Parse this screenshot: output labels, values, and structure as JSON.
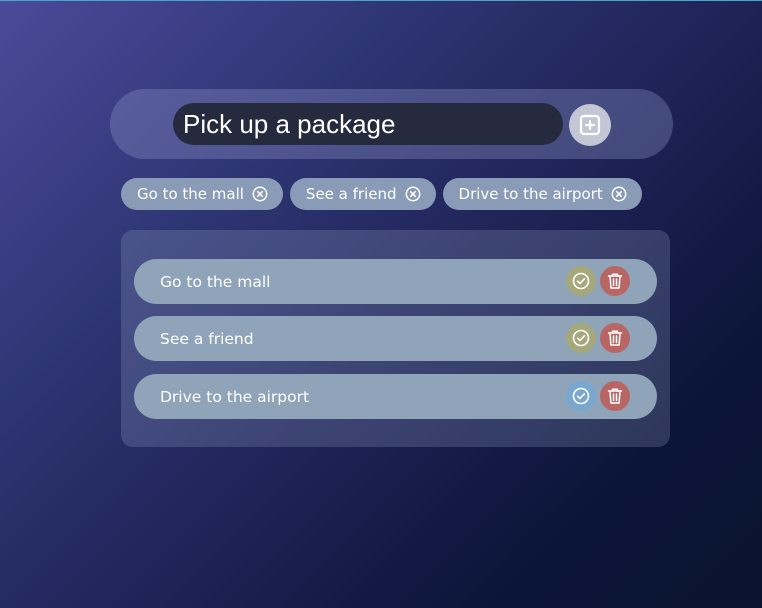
{
  "input": {
    "value": "Pick up a package"
  },
  "icons": {
    "add": "plus-square-icon",
    "remove": "x-circle-icon",
    "complete": "check-circle-icon",
    "delete": "trash-icon"
  },
  "colors": {
    "check_done": "#a4a87a",
    "check_pending": "#79a7cf",
    "delete": "#b86664"
  },
  "chips": [
    {
      "label": "Go to the mall"
    },
    {
      "label": "See a friend"
    },
    {
      "label": "Drive to the airport"
    }
  ],
  "tasks": [
    {
      "label": "Go to the mall",
      "check_color": "#a4a87a"
    },
    {
      "label": "See a friend",
      "check_color": "#a4a87a"
    },
    {
      "label": "Drive to the airport",
      "check_color": "#79a7cf"
    }
  ]
}
